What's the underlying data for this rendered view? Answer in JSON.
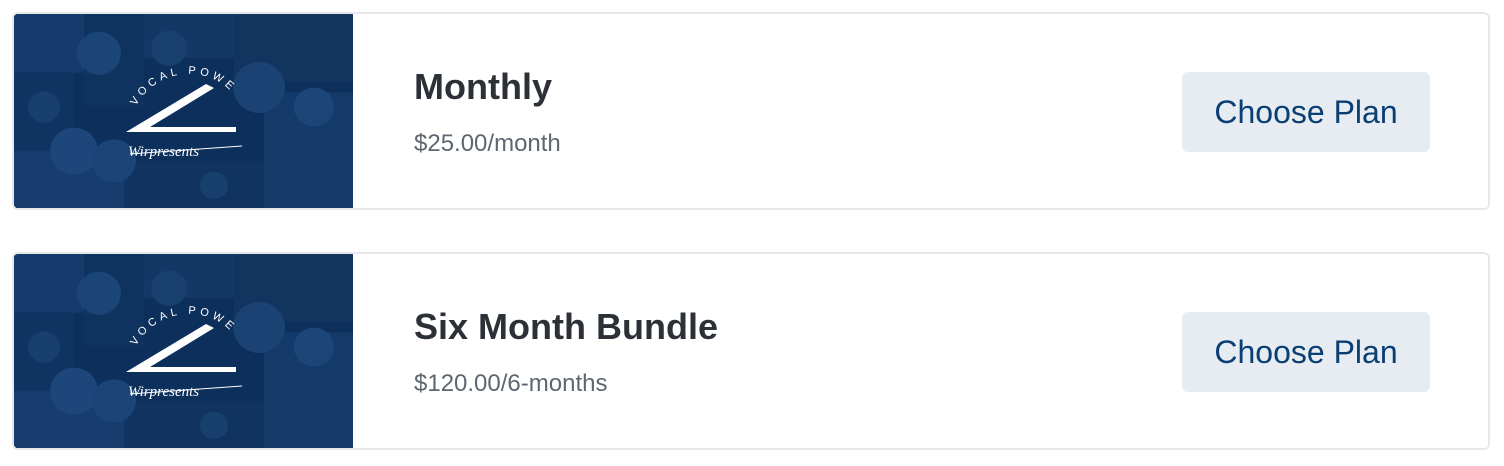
{
  "plans": [
    {
      "thumbnail": {
        "logo_arc_text": "VOCAL POWER",
        "logo_signature": "Wirpresents"
      },
      "name": "Monthly",
      "price": "$25.00/month",
      "button_label": "Choose Plan"
    },
    {
      "thumbnail": {
        "logo_arc_text": "VOCAL POWER",
        "logo_signature": "Wirpresents"
      },
      "name": "Six Month Bundle",
      "price": "$120.00/6-months",
      "button_label": "Choose Plan"
    }
  ],
  "colors": {
    "thumbnail_overlay": "#0d2f5c",
    "button_bg": "#e6ecf2",
    "button_text": "#0a3f74",
    "title_text": "#2c3138",
    "price_text": "#5e6670",
    "card_border": "#e6e8eb"
  }
}
